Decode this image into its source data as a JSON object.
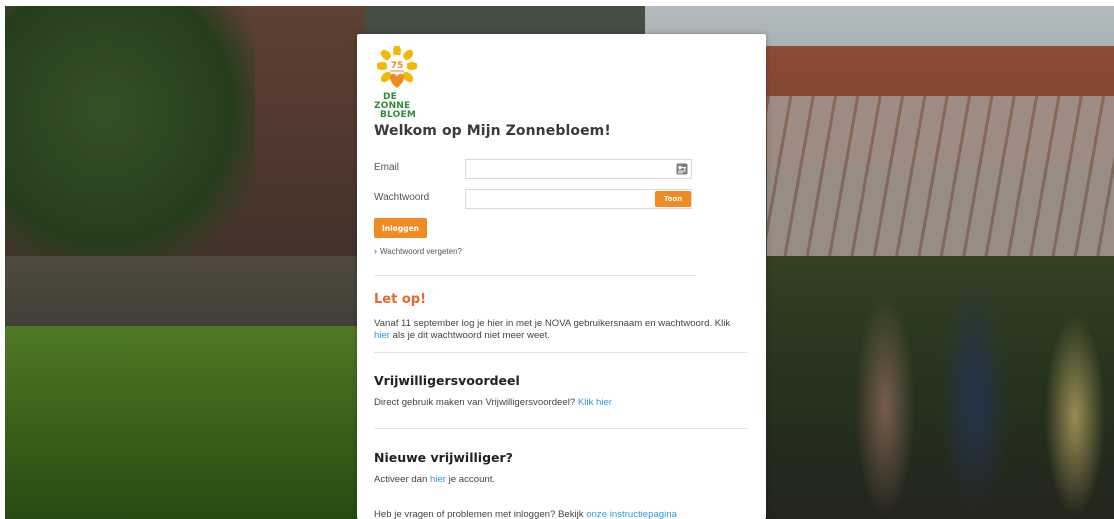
{
  "logo": {
    "badge_number": "75",
    "brand_lines": [
      "DE",
      "ZONNE",
      "BLOEM"
    ],
    "icon": "sunflower-heart-logo"
  },
  "page": {
    "title": "Welkom op Mijn Zonnebloem!"
  },
  "form": {
    "email_label": "Email",
    "email_value": "",
    "email_icon": "key-icon",
    "password_label": "Wachtwoord",
    "password_value": "",
    "show_button": "Toon",
    "login_button": "Inloggen",
    "forgot_link": "Wachtwoord vergeten?"
  },
  "notice": {
    "heading": "Let op!",
    "text_before": "Vanaf 11 september log je hier in met je NOVA gebruikersnaam en wachtwoord. Klik ",
    "link": "hier",
    "text_after": " als je dit wachtwoord niet meer weet."
  },
  "volunteer_benefit": {
    "heading": "Vrijwilligersvoordeel",
    "text": "Direct gebruik maken van Vrijwilligersvoordeel? ",
    "link": "Klik hier"
  },
  "new_volunteer": {
    "heading": "Nieuwe vrijwilliger?",
    "text_before": "Activeer dan ",
    "link": "hier",
    "text_after": " je account."
  },
  "help": {
    "text": "Heb je vragen of problemen met inloggen? Bekijk ",
    "link": "onze instructiepagina"
  },
  "colors": {
    "accent_orange": "#f08a22",
    "notice_orange": "#e8672b",
    "link_blue": "#2a9fd6",
    "brand_green": "#2f8a3c",
    "logo_yellow": "#f5b800"
  }
}
